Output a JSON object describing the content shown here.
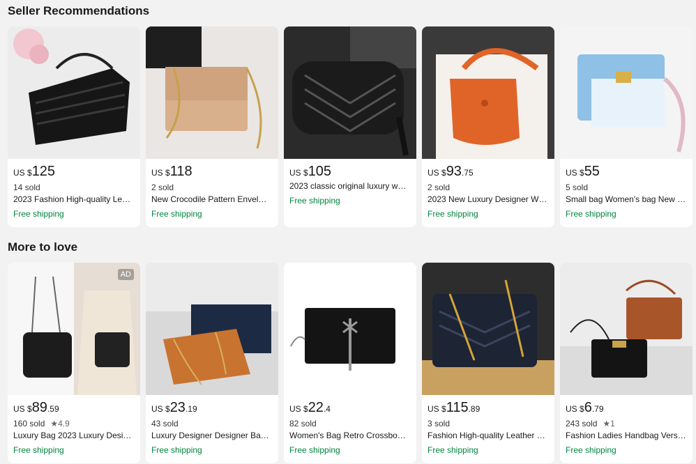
{
  "sections": [
    {
      "title": "Seller Recommendations",
      "products": [
        {
          "currency": "US $",
          "price_int": "125",
          "price_dec": "",
          "sold": "14 sold",
          "rating": "",
          "title": "2023 Fashion High-quality Le…",
          "shipping": "Free shipping",
          "ad": ""
        },
        {
          "currency": "US $",
          "price_int": "118",
          "price_dec": "",
          "sold": "2 sold",
          "rating": "",
          "title": "New Crocodile Pattern Envel…",
          "shipping": "Free shipping",
          "ad": ""
        },
        {
          "currency": "US $",
          "price_int": "105",
          "price_dec": "",
          "sold": "",
          "rating": "",
          "title": "2023 classic original luxury w…",
          "shipping": "Free shipping",
          "ad": ""
        },
        {
          "currency": "US $",
          "price_int": "93",
          "price_dec": ".75",
          "sold": "2 sold",
          "rating": "",
          "title": "2023 New Luxury Designer W…",
          "shipping": "Free shipping",
          "ad": ""
        },
        {
          "currency": "US $",
          "price_int": "55",
          "price_dec": "",
          "sold": "5 sold",
          "rating": "",
          "title": "Small bag Women's bag New …",
          "shipping": "Free shipping",
          "ad": ""
        }
      ]
    },
    {
      "title": "More to love",
      "products": [
        {
          "currency": "US $",
          "price_int": "89",
          "price_dec": ".59",
          "sold": "160 sold",
          "rating": "★4.9",
          "title": "Luxury Bag 2023 Luxury Desi…",
          "shipping": "Free shipping",
          "ad": "AD"
        },
        {
          "currency": "US $",
          "price_int": "23",
          "price_dec": ".19",
          "sold": "43 sold",
          "rating": "",
          "title": "Luxury Designer Designer Ba…",
          "shipping": "Free shipping",
          "ad": ""
        },
        {
          "currency": "US $",
          "price_int": "22",
          "price_dec": ".4",
          "sold": "82 sold",
          "rating": "",
          "title": "Women's Bag Retro Crossbo…",
          "shipping": "Free shipping",
          "ad": ""
        },
        {
          "currency": "US $",
          "price_int": "115",
          "price_dec": ".89",
          "sold": "3 sold",
          "rating": "",
          "title": "Fashion High-quality Leather …",
          "shipping": "Free shipping",
          "ad": ""
        },
        {
          "currency": "US $",
          "price_int": "6",
          "price_dec": ".79",
          "sold": "243 sold",
          "rating": "★1",
          "title": "Fashion Ladies Handbag Vers…",
          "shipping": "Free shipping",
          "ad": ""
        }
      ]
    }
  ]
}
